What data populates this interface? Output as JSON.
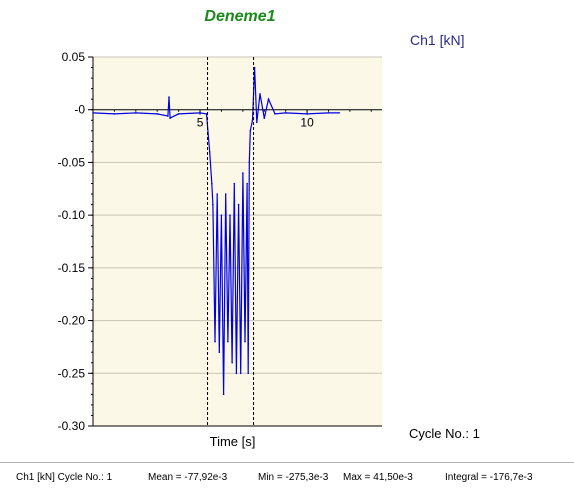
{
  "chart_data": {
    "type": "line",
    "title": "Deneme1",
    "series_label": "Ch1 [kN]",
    "xlabel": "Time [s]",
    "ylabel": "",
    "xlim": [
      0,
      13.5
    ],
    "ylim": [
      -0.3,
      0.05
    ],
    "xticks": [
      5,
      10
    ],
    "xtick_labels": [
      "5",
      "10"
    ],
    "yticks": [
      0.05,
      0,
      -0.05,
      -0.1,
      -0.15,
      -0.2,
      -0.25,
      -0.3
    ],
    "ytick_labels": [
      "0.05",
      "-0",
      "-0.05",
      "-0.10",
      "-0.15",
      "-0.20",
      "-0.25",
      "-0.30"
    ],
    "cursor_lines_x": [
      5.35,
      7.5
    ],
    "grid": true,
    "plot_background": "#fbf8e8",
    "series": [
      {
        "name": "Ch1 [kN]",
        "color": "#0000e0",
        "x": [
          0.0,
          1.0,
          2.0,
          3.0,
          3.5,
          3.55,
          3.6,
          4.0,
          5.0,
          5.3,
          5.45,
          5.55,
          5.6,
          5.7,
          5.8,
          5.9,
          6.0,
          6.1,
          6.2,
          6.3,
          6.4,
          6.5,
          6.6,
          6.7,
          6.8,
          6.9,
          7.0,
          7.1,
          7.2,
          7.25,
          7.3,
          7.35,
          7.45,
          7.55,
          7.65,
          7.8,
          8.0,
          8.2,
          8.5,
          9.0,
          10.0,
          11.0,
          11.5
        ],
        "y": [
          -0.003,
          -0.004,
          -0.003,
          -0.004,
          -0.006,
          0.012,
          -0.008,
          -0.004,
          -0.003,
          -0.004,
          -0.04,
          -0.07,
          -0.09,
          -0.22,
          -0.08,
          -0.23,
          -0.1,
          -0.27,
          -0.08,
          -0.22,
          -0.1,
          -0.24,
          -0.07,
          -0.25,
          -0.09,
          -0.25,
          -0.06,
          -0.22,
          -0.07,
          -0.25,
          -0.05,
          -0.02,
          -0.01,
          0.04,
          -0.012,
          0.015,
          -0.008,
          0.01,
          -0.004,
          -0.003,
          -0.004,
          -0.003,
          -0.003
        ]
      }
    ]
  },
  "cycle_label": "Cycle No.: 1",
  "status": {
    "channel": "Ch1 [kN] Cycle No.: 1",
    "mean": "Mean = -77,92e-3",
    "min": "Min = -275,3e-3",
    "max": "Max = 41,50e-3",
    "integral": "Integral = -176,7e-3"
  }
}
